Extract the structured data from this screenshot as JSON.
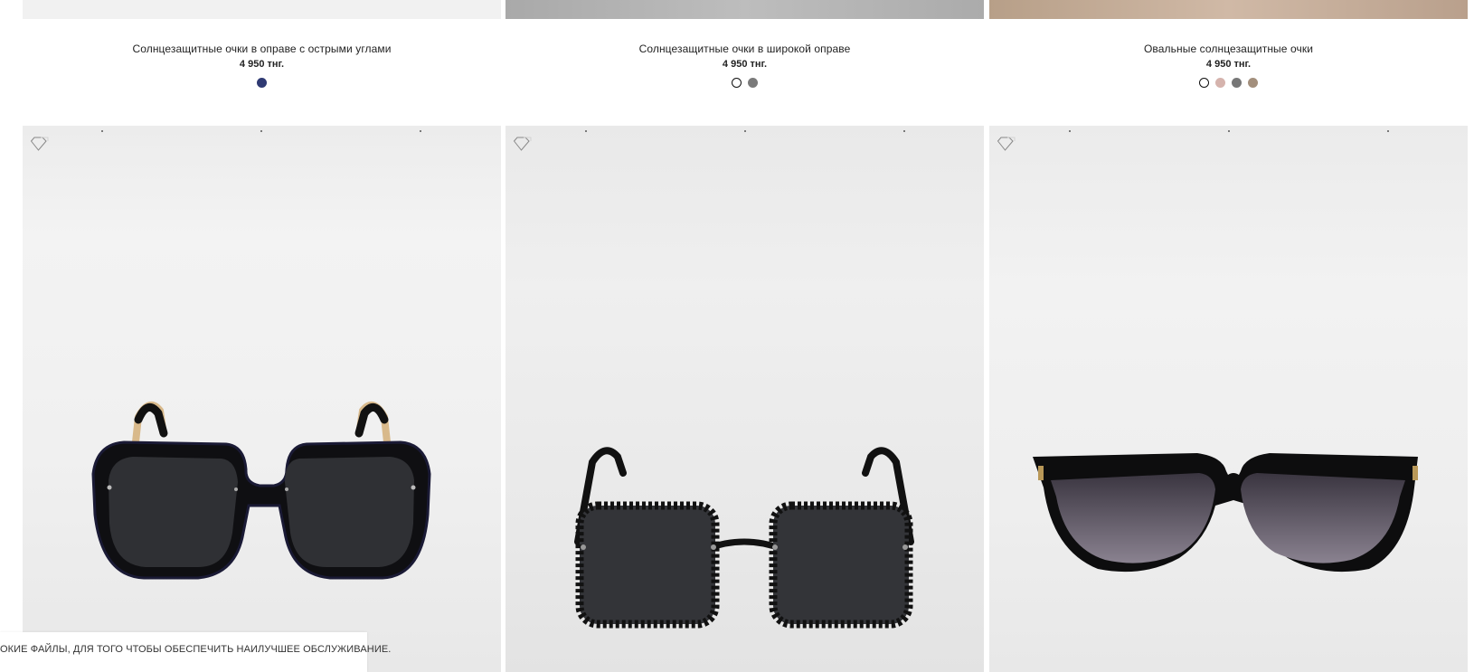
{
  "products_top": [
    {
      "name": "Солнцезащитные очки в оправе с острыми углами",
      "price": "4 950 тнг.",
      "swatches": [
        {
          "color": "#2f3a73",
          "style": "filled"
        }
      ]
    },
    {
      "name": "Солнцезащитные очки в широкой оправе",
      "price": "4 950 тнг.",
      "swatches": [
        {
          "color": "#111111",
          "style": "outline"
        },
        {
          "color": "#7a7a7a",
          "style": "filled"
        }
      ]
    },
    {
      "name": "Овальные солнцезащитные очки",
      "price": "4 950 тнг.",
      "swatches": [
        {
          "color": "#111111",
          "style": "outline"
        },
        {
          "color": "#d5b3ad",
          "style": "filled"
        },
        {
          "color": "#777777",
          "style": "filled"
        },
        {
          "color": "#a38f7c",
          "style": "filled"
        }
      ]
    }
  ],
  "product_cards": [
    {
      "image": "black square sunglasses with gold temples",
      "favorite_icon": "diamond-icon"
    },
    {
      "image": "black square chain-frame sunglasses",
      "favorite_icon": "diamond-icon"
    },
    {
      "image": "black cat-eye gradient sunglasses",
      "favorite_icon": "diamond-icon"
    }
  ],
  "cookie_banner": {
    "text": "ОКИЕ ФАЙЛЫ, ДЛЯ ТОГО ЧТОБЫ ОБЕСПЕЧИТЬ НАИЛУЧШЕЕ ОБСЛУЖИВАНИЕ."
  }
}
